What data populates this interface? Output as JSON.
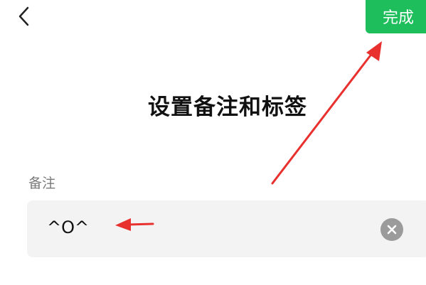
{
  "header": {
    "back_icon": "chevron-left-icon",
    "done_label": "完成",
    "done_color": "#1ebe5d"
  },
  "page": {
    "title": "设置备注和标签"
  },
  "remark": {
    "label": "备注",
    "value": "^O^",
    "clear_icon": "clear-circle-icon"
  },
  "annotations": {
    "color": "#e8312f",
    "arrows": [
      "arrow-to-done-button",
      "arrow-to-remark-value"
    ]
  }
}
